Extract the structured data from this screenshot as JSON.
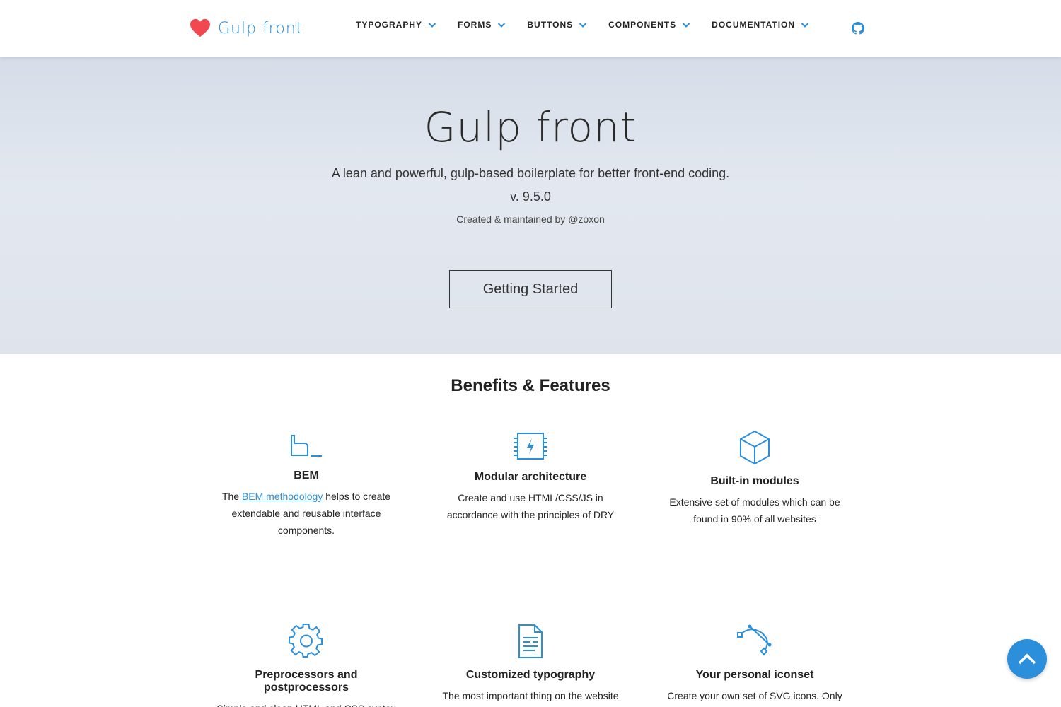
{
  "header": {
    "logo_text": "Gulp front",
    "nav": [
      {
        "label": "TYPOGRAPHY"
      },
      {
        "label": "FORMS"
      },
      {
        "label": "BUTTONS"
      },
      {
        "label": "COMPONENTS"
      },
      {
        "label": "DOCUMENTATION"
      }
    ],
    "github_icon": "github-icon"
  },
  "hero": {
    "title": "Gulp front",
    "subtitle": "A lean and powerful, gulp-based boilerplate for better front-end coding.",
    "version": "v. 9.5.0",
    "credit": "Created & maintained by @zoxon",
    "cta_label": "Getting Started"
  },
  "features": {
    "title": "Benefits & Features",
    "items": [
      {
        "icon": "bem-icon",
        "title": "BEM",
        "text_before": "The ",
        "link": "BEM methodology",
        "text_after": " helps to create extendable and reusable interface components."
      },
      {
        "icon": "chip-icon",
        "title": "Modular architecture",
        "text": "Create and use HTML/CSS/JS in accordance with the principles of DRY"
      },
      {
        "icon": "cube-icon",
        "title": "Built-in modules",
        "text": "Extensive set of modules which can be found in 90% of all websites"
      },
      {
        "icon": "gear-icon",
        "title": "Preprocessors and postprocessors",
        "text": "Simple and clean HTML and CSS syntax"
      },
      {
        "icon": "document-icon",
        "title": "Customized typography",
        "text": "The most important thing on the website is"
      },
      {
        "icon": "vector-path-icon",
        "title": "Your personal iconset",
        "text": "Create your own set of SVG icons. Only"
      }
    ]
  },
  "colors": {
    "accent": "#2b8fdb",
    "heart": "#f2474f",
    "hero_bg": "#dfe4ec"
  },
  "scroll_top_icon": "chevron-up-icon"
}
